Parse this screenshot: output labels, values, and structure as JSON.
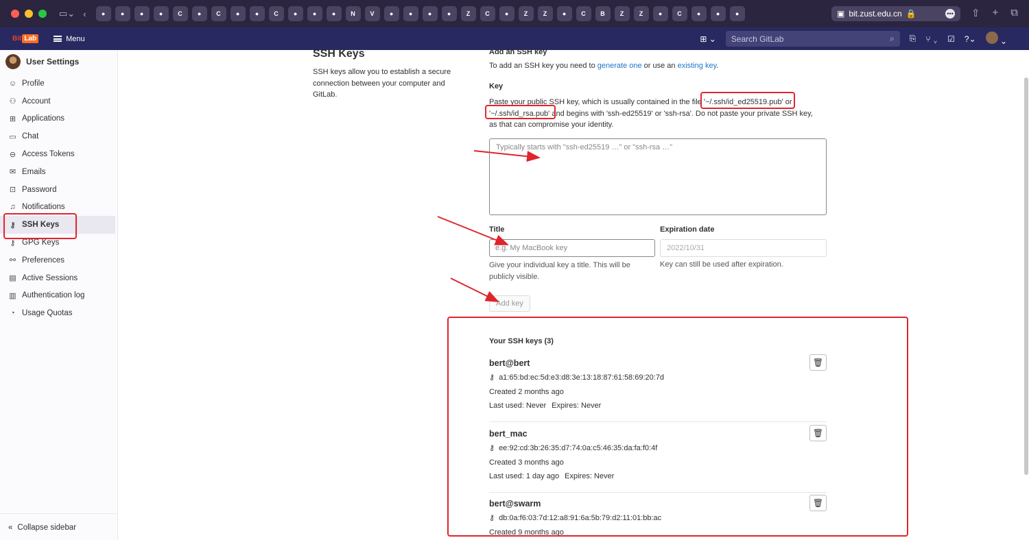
{
  "browser": {
    "address": "bit.zust.edu.cn",
    "tabs": [
      "C",
      "Z",
      "C",
      "B",
      "Z",
      "Z",
      "N",
      "V",
      "C",
      "C",
      "Z",
      "Z"
    ]
  },
  "topnav": {
    "logo_prefix": "Bit",
    "logo_suffix": "Lab",
    "menu_label": "Menu",
    "search_placeholder": "Search GitLab"
  },
  "sidebar": {
    "title": "User Settings",
    "items": [
      {
        "label": "Profile",
        "icon": "profile-icon"
      },
      {
        "label": "Account",
        "icon": "account-icon"
      },
      {
        "label": "Applications",
        "icon": "applications-icon"
      },
      {
        "label": "Chat",
        "icon": "chat-icon"
      },
      {
        "label": "Access Tokens",
        "icon": "token-icon"
      },
      {
        "label": "Emails",
        "icon": "mail-icon"
      },
      {
        "label": "Password",
        "icon": "lock-icon"
      },
      {
        "label": "Notifications",
        "icon": "bell-icon"
      },
      {
        "label": "SSH Keys",
        "icon": "key-icon"
      },
      {
        "label": "GPG Keys",
        "icon": "key-icon"
      },
      {
        "label": "Preferences",
        "icon": "preferences-icon"
      },
      {
        "label": "Active Sessions",
        "icon": "monitor-icon"
      },
      {
        "label": "Authentication log",
        "icon": "log-icon"
      },
      {
        "label": "Usage Quotas",
        "icon": "quota-icon"
      }
    ],
    "collapse_label": "Collapse sidebar"
  },
  "page": {
    "title": "SSH Keys",
    "description": "SSH keys allow you to establish a secure connection between your computer and GitLab.",
    "add_heading": "Add an SSH key",
    "intro_prefix": "To add an SSH key you need to ",
    "intro_link1": "generate one",
    "intro_middle": " or use an ",
    "intro_link2": "existing key",
    "intro_suffix": ".",
    "key_label": "Key",
    "key_help": "Paste your public SSH key, which is usually contained in the file '~/.ssh/id_ed25519.pub' or '~/.ssh/id_rsa.pub' and begins with 'ssh-ed25519' or 'ssh-rsa'. Do not paste your private SSH key, as that can compromise your identity.",
    "key_placeholder": "Typically starts with \"ssh-ed25519 …\" or \"ssh-rsa …\"",
    "title_label": "Title",
    "title_placeholder": "e.g. My MacBook key",
    "title_help": "Give your individual key a title. This will be publicly visible.",
    "expiration_label": "Expiration date",
    "expiration_value": "2022/10/31",
    "expiration_help": "Key can still be used after expiration.",
    "add_button": "Add key",
    "keys_heading": "Your SSH keys (3)",
    "keys": [
      {
        "title": "bert@bert",
        "fingerprint": "a1:65:bd:ec:5d:e3:d8:3e:13:18:87:61:58:69:20:7d",
        "created": "Created 2 months ago",
        "last_used": "Last used: Never",
        "expires": "Expires: Never"
      },
      {
        "title": "bert_mac",
        "fingerprint": "ee:92:cd:3b:26:35:d7:74:0a:c5:46:35:da:fa:f0:4f",
        "created": "Created 3 months ago",
        "last_used": "Last used: 1 day ago",
        "expires": "Expires: Never"
      },
      {
        "title": "bert@swarm",
        "fingerprint": "db:0a:f6:03:7d:12:a8:91:6a:5b:79:d2:11:01:bb:ac",
        "created": "Created 9 months ago",
        "last_used": "",
        "expires": ""
      }
    ]
  },
  "colors": {
    "nav_bg": "#292961",
    "browser_bg": "#2b2540",
    "link": "#1f75cb",
    "annotation": "#e0242c"
  }
}
